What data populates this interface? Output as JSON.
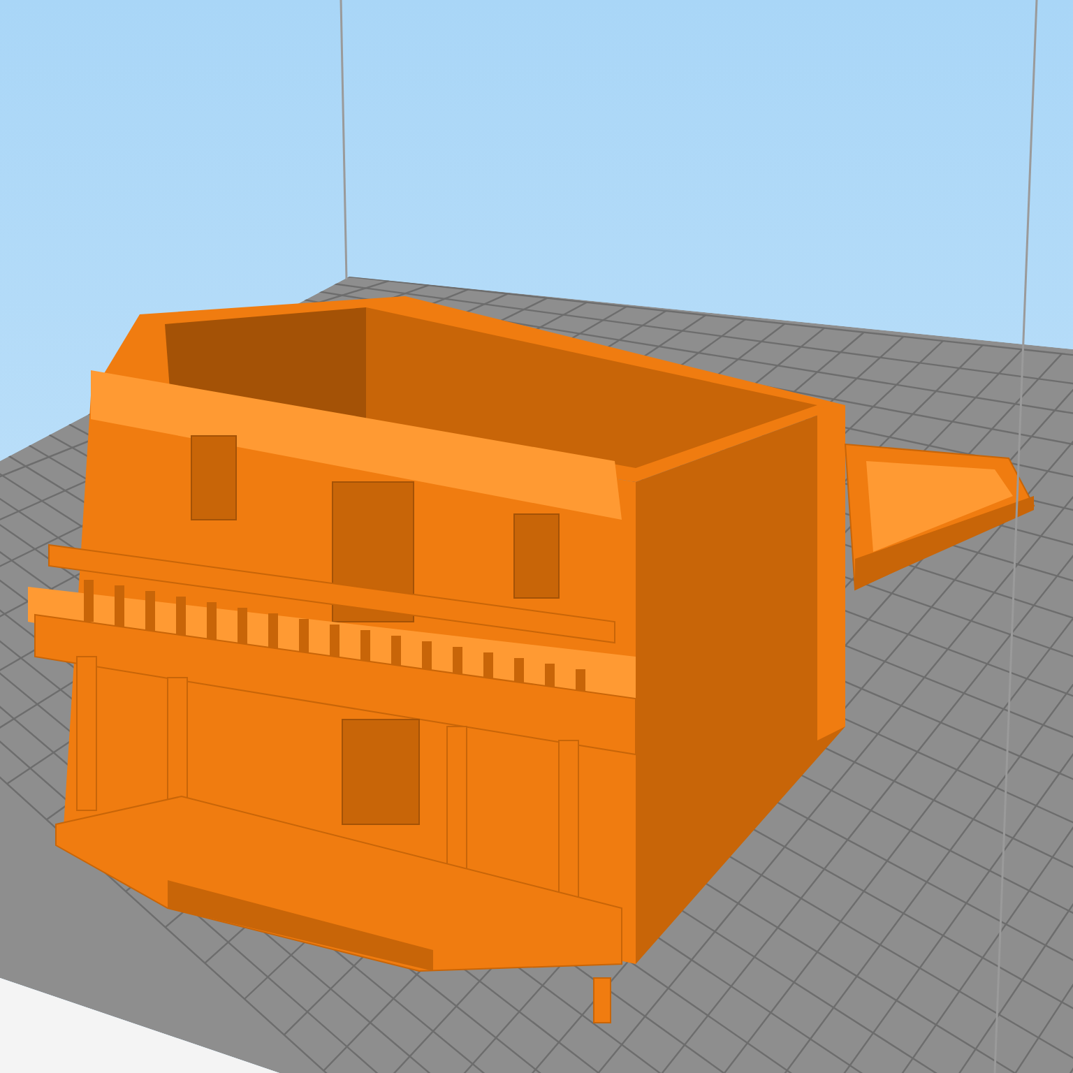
{
  "scene": {
    "objects": [
      {
        "kind": "building"
      },
      {
        "kind": "porch-piece"
      }
    ]
  }
}
